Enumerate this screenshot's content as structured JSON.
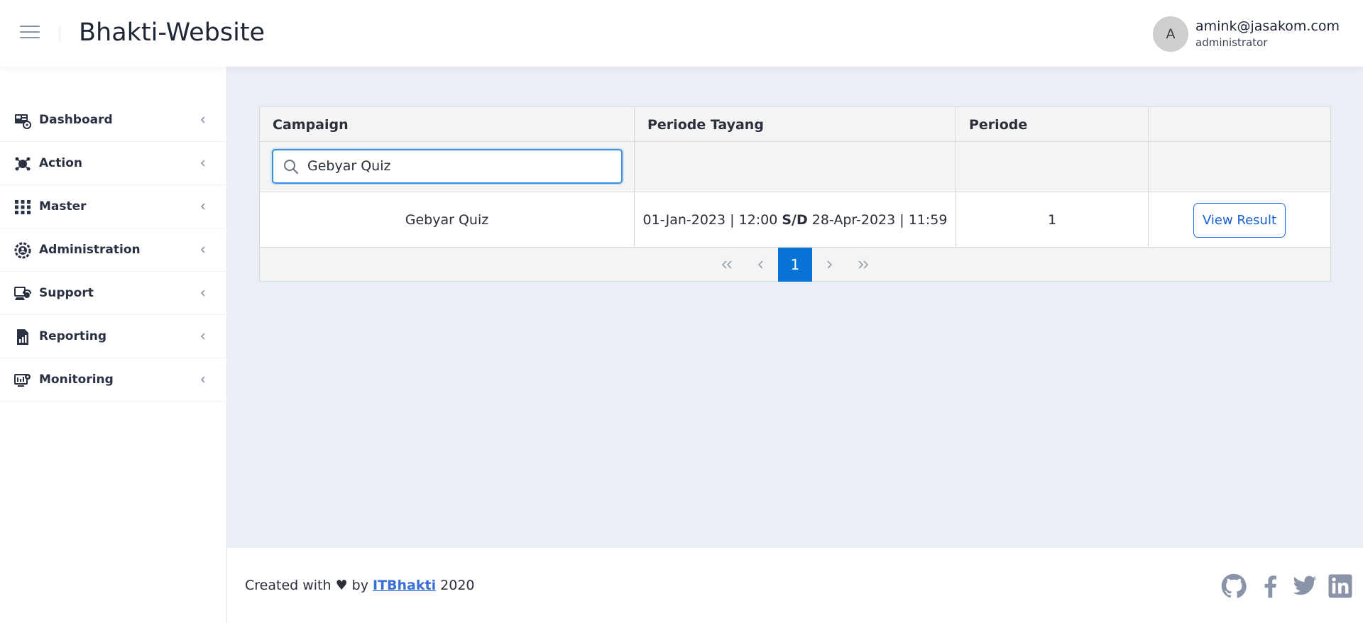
{
  "header": {
    "app_title": "Bhakti-Website",
    "avatar_initial": "A",
    "user_email": "amink@jasakom.com",
    "user_role": "administrator"
  },
  "sidebar": {
    "items": [
      {
        "label": "Dashboard",
        "icon": "dashboard-icon"
      },
      {
        "label": "Action",
        "icon": "action-icon"
      },
      {
        "label": "Master",
        "icon": "master-icon"
      },
      {
        "label": "Administration",
        "icon": "administration-icon"
      },
      {
        "label": "Support",
        "icon": "support-icon"
      },
      {
        "label": "Reporting",
        "icon": "reporting-icon"
      },
      {
        "label": "Monitoring",
        "icon": "monitoring-icon"
      }
    ]
  },
  "table": {
    "headers": [
      "Campaign",
      "Periode Tayang",
      "Periode",
      ""
    ],
    "search": {
      "value": "Gebyar Quiz",
      "icon": "search-icon"
    },
    "rows": [
      {
        "campaign": "Gebyar Quiz",
        "start": "01-Jan-2023 | 12:00",
        "separator": "S/D",
        "end": "28-Apr-2023 | 11:59",
        "periode": "1",
        "action": "View Result"
      }
    ],
    "pagination": {
      "first": "«",
      "prev": "‹",
      "current": "1",
      "next": "›",
      "last": "»"
    }
  },
  "footer": {
    "prefix": "Created with ♥ by",
    "link": "ITBhakti",
    "year": "2020",
    "social": [
      "github-icon",
      "facebook-icon",
      "twitter-icon",
      "linkedin-icon"
    ]
  },
  "colors": {
    "accent": "#0a74d6",
    "link": "#3a6fd8",
    "background": "#eaeef5",
    "icon_muted": "#8a94a8"
  }
}
